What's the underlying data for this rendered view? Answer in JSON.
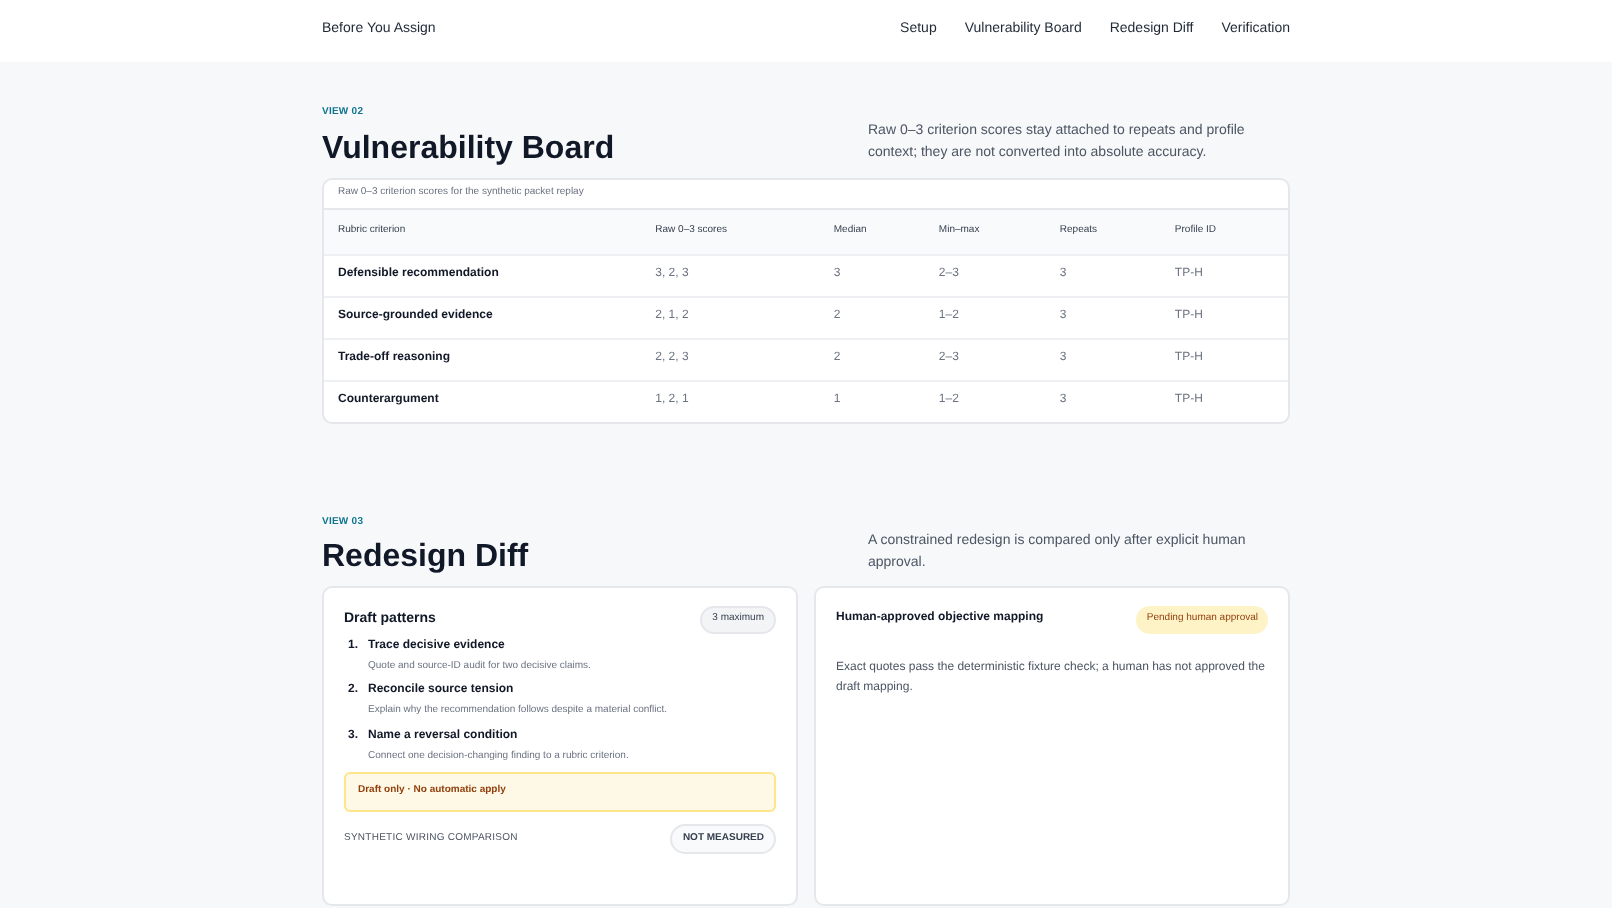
{
  "nav": {
    "brand": "Before You Assign",
    "links": [
      "Setup",
      "Vulnerability Board",
      "Redesign Diff",
      "Verification"
    ]
  },
  "board": {
    "eyebrow": "VIEW 02",
    "title": "Vulnerability Board",
    "summary": "Raw 0–3 criterion scores stay attached to repeats and profile context; they are not converted into absolute accuracy.",
    "table": {
      "caption": "Raw 0–3 criterion scores for the synthetic packet replay",
      "columns": [
        "Rubric criterion",
        "Raw 0–3 scores",
        "Median",
        "Min–max",
        "Repeats",
        "Profile ID"
      ],
      "rows": [
        [
          "Defensible recommendation",
          "3, 2, 3",
          "3",
          "2–3",
          "3",
          "TP-H"
        ],
        [
          "Source-grounded evidence",
          "2, 1, 2",
          "2",
          "1–2",
          "3",
          "TP-H"
        ],
        [
          "Trade-off reasoning",
          "2, 2, 3",
          "2",
          "2–3",
          "3",
          "TP-H"
        ],
        [
          "Counterargument",
          "1, 2, 1",
          "1",
          "1–2",
          "3",
          "TP-H"
        ]
      ]
    }
  },
  "diff": {
    "eyebrow": "VIEW 03",
    "title": "Redesign Diff",
    "summary": "A constrained redesign is compared only after explicit human approval.",
    "draft": {
      "title": "Draft patterns",
      "badge": "3 maximum",
      "patterns": [
        {
          "number": "1.",
          "title": "Trace decisive evidence",
          "detail": "Quote and source-ID audit for two decisive claims."
        },
        {
          "number": "2.",
          "title": "Reconcile source tension",
          "detail": "Explain why the recommendation follows despite a material conflict."
        },
        {
          "number": "3.",
          "title": "Name a reversal condition",
          "detail": "Connect one decision-changing finding to a rubric criterion."
        }
      ],
      "notice": "Draft only · No automatic apply",
      "comparison_label": "SYNTHETIC WIRING COMPARISON",
      "comparison_badge": "NOT MEASURED"
    },
    "mapping": {
      "title": "Human-approved objective mapping",
      "badge": "Pending human approval",
      "body": "Exact quotes pass the deterministic fixture check; a human has not approved the draft mapping."
    }
  }
}
